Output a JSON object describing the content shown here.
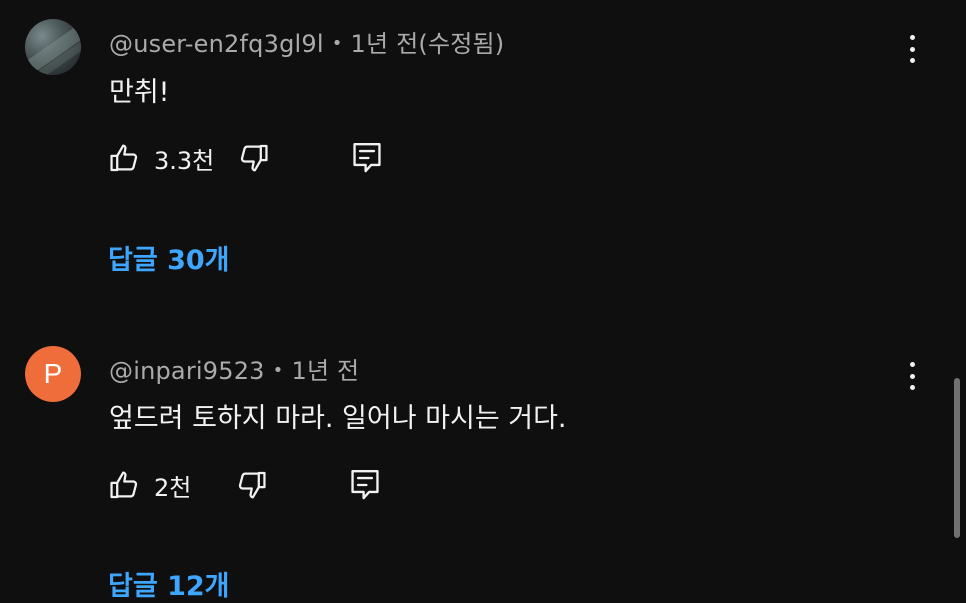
{
  "comments": [
    {
      "author": "@user-en2fq3gl9l",
      "time": "1년 전(수정됨)",
      "text": "만취!",
      "likes": "3.3천",
      "replies": "답글 30개",
      "avatar": {
        "type": "photo",
        "letter": ""
      }
    },
    {
      "author": "@inpari9523",
      "time": "1년 전",
      "text": "엎드려 토하지 마라. 일어나 마시는 거다.",
      "likes": "2천",
      "replies": "답글 12개",
      "avatar": {
        "type": "letter",
        "letter": "P",
        "color": "#ef6c3b"
      }
    }
  ],
  "separator": "•",
  "icons": {
    "like": "thumbs-up-icon",
    "dislike": "thumbs-down-icon",
    "reply": "reply-comment-icon",
    "more": "more-vert-icon"
  },
  "colors": {
    "background": "#0f0f0f",
    "link": "#3ea6ff",
    "meta": "#aaaaaa",
    "text": "#f1f1f1"
  }
}
